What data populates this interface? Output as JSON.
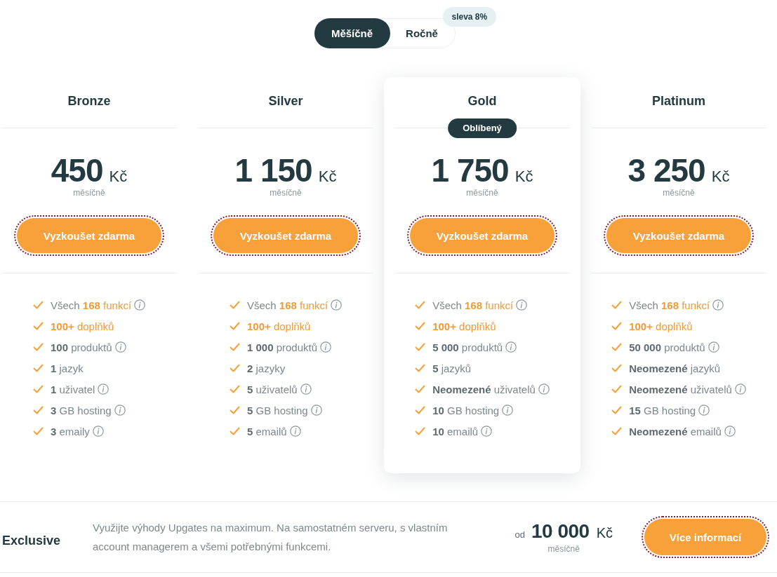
{
  "billing_toggle": {
    "options": [
      {
        "label": "Měšíčně",
        "selected": true
      },
      {
        "label": "Ročně",
        "selected": false
      }
    ],
    "discount_badge": "sleva 8%"
  },
  "plans": [
    {
      "name": "Bronze",
      "featured": false,
      "price": "450",
      "currency": "Kč",
      "period": "měsíčně",
      "button": "Vyzkoušet zdarma",
      "features": [
        {
          "prefix": "Všech",
          "text": "**168** funkcí",
          "highlighted": true,
          "info": true
        },
        {
          "text": "**100+** doplňků",
          "highlighted": true,
          "info": false
        },
        {
          "text": "**100** produktů",
          "highlighted": false,
          "info": true
        },
        {
          "text": "**1** jazyk",
          "highlighted": false,
          "info": false
        },
        {
          "text": "**1** uživatel",
          "highlighted": false,
          "info": true
        },
        {
          "text": "**3** GB hosting",
          "highlighted": false,
          "info": true
        },
        {
          "text": "**3** emaily",
          "highlighted": false,
          "info": true
        }
      ]
    },
    {
      "name": "Silver",
      "featured": false,
      "price": "1 150",
      "currency": "Kč",
      "period": "měsíčně",
      "button": "Vyzkoušet zdarma",
      "features": [
        {
          "prefix": "Všech",
          "text": "**168** funkcí",
          "highlighted": true,
          "info": true
        },
        {
          "text": "**100+** doplňků",
          "highlighted": true,
          "info": false
        },
        {
          "text": "**1 000** produktů",
          "highlighted": false,
          "info": true
        },
        {
          "text": "**2** jazyky",
          "highlighted": false,
          "info": false
        },
        {
          "text": "**5** uživatelů",
          "highlighted": false,
          "info": true
        },
        {
          "text": "**5** GB hosting",
          "highlighted": false,
          "info": true
        },
        {
          "text": "**5** emailů",
          "highlighted": false,
          "info": true
        }
      ]
    },
    {
      "name": "Gold",
      "featured": true,
      "badge": "Oblíbený",
      "price": "1 750",
      "currency": "Kč",
      "period": "měsíčně",
      "button": "Vyzkoušet zdarma",
      "features": [
        {
          "prefix": "Všech",
          "text": "**168** funkcí",
          "highlighted": true,
          "info": true
        },
        {
          "text": "**100+** doplňků",
          "highlighted": true,
          "info": false
        },
        {
          "text": "**5 000** produktů",
          "highlighted": false,
          "info": true
        },
        {
          "text": "**5** jazyků",
          "highlighted": false,
          "info": false
        },
        {
          "text": "**Neomezené** uživatelů",
          "highlighted": false,
          "info": true
        },
        {
          "text": "**10** GB hosting",
          "highlighted": false,
          "info": true
        },
        {
          "text": "**10** emailů",
          "highlighted": false,
          "info": true
        }
      ]
    },
    {
      "name": "Platinum",
      "featured": false,
      "price": "3 250",
      "currency": "Kč",
      "period": "měsíčně",
      "button": "Vyzkoušet zdarma",
      "features": [
        {
          "prefix": "Všech",
          "text": "**168** funkcí",
          "highlighted": true,
          "info": true
        },
        {
          "text": "**100+** doplňků",
          "highlighted": true,
          "info": false
        },
        {
          "text": "**50 000** produktů",
          "highlighted": false,
          "info": true
        },
        {
          "text": "**Neomezené** jazyků",
          "highlighted": false,
          "info": false
        },
        {
          "text": "**Neomezené** uživatelů",
          "highlighted": false,
          "info": true
        },
        {
          "text": "**15** GB hosting",
          "highlighted": false,
          "info": true
        },
        {
          "text": "**Neomezené** emailů",
          "highlighted": false,
          "info": true
        }
      ]
    }
  ],
  "exclusive": {
    "name": "Exclusive",
    "description": "Využijte výhody Upgates na maximum. Na samostatném serveru, s vlastním account managerem a všemi potřebnými funkcemi.",
    "price_prefix": "od",
    "price": "10 000",
    "currency": "Kč",
    "period": "měsíčně",
    "button": "Více informací"
  }
}
